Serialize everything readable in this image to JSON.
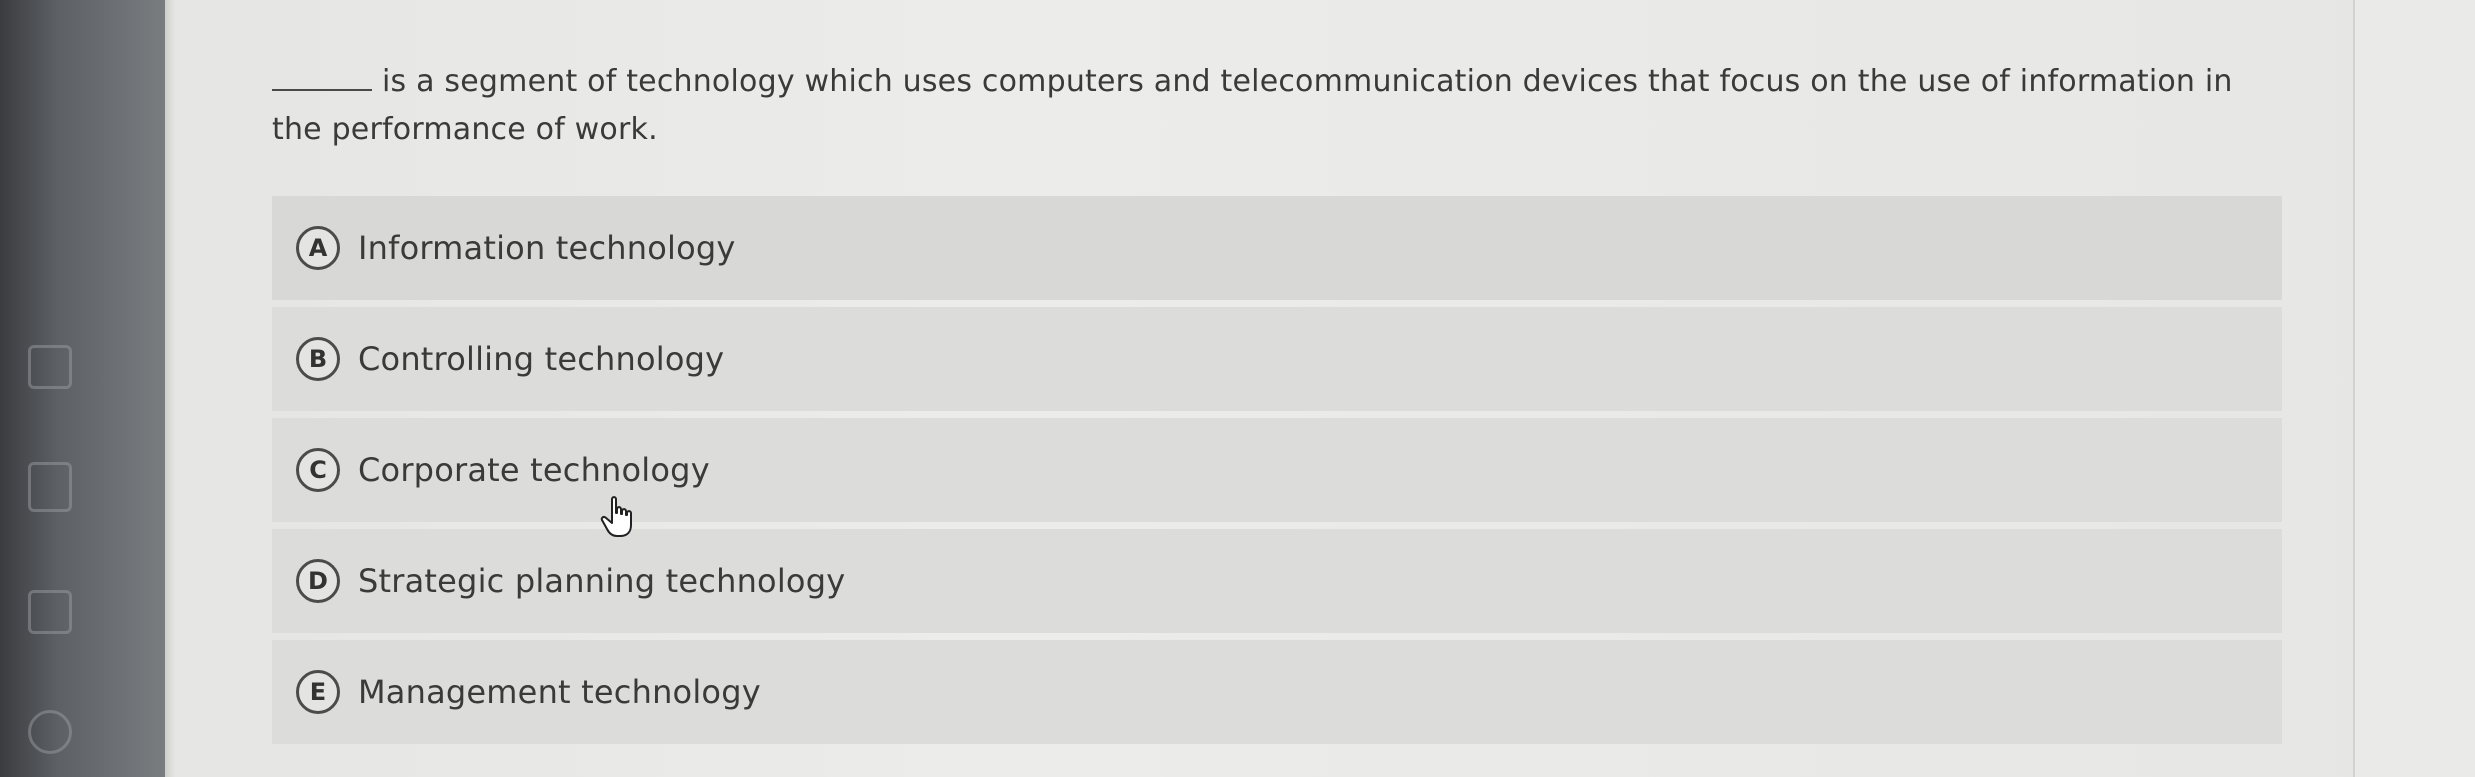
{
  "question": {
    "blank": "______",
    "text": "is a segment of technology which uses computers and telecommunication devices that focus on the use of information in the performance of work."
  },
  "options": [
    {
      "letter": "A",
      "label": "Information technology"
    },
    {
      "letter": "B",
      "label": "Controlling technology"
    },
    {
      "letter": "C",
      "label": "Corporate technology"
    },
    {
      "letter": "D",
      "label": "Strategic planning technology"
    },
    {
      "letter": "E",
      "label": "Management technology"
    }
  ],
  "colors": {
    "background": "#e9e9e7",
    "option_row": "#dcdcda",
    "text": "#3a3a3a",
    "rail": "#5d6064"
  },
  "icons": [
    "hand-pointer-cursor-icon"
  ]
}
